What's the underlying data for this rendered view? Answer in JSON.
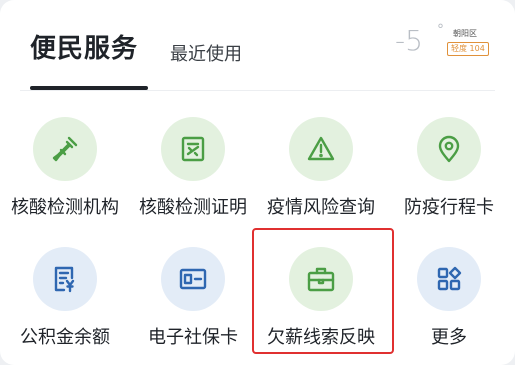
{
  "header": {
    "tab_main": "便民服务",
    "tab_secondary": "最近使用"
  },
  "weather": {
    "temperature": "-5",
    "degree_symbol": "°",
    "district": "朝阳区",
    "aqi_label": "轻度 104"
  },
  "services": [
    {
      "label": "核酸检测机构",
      "icon": "dropper-icon"
    },
    {
      "label": "核酸检测证明",
      "icon": "certificate-icon"
    },
    {
      "label": "疫情风险查询",
      "icon": "warning-icon"
    },
    {
      "label": "防疫行程卡",
      "icon": "location-pin-icon"
    },
    {
      "label": "公积金余额",
      "icon": "fund-document-icon"
    },
    {
      "label": "电子社保卡",
      "icon": "id-card-icon"
    },
    {
      "label": "欠薪线索反映",
      "icon": "briefcase-icon"
    },
    {
      "label": "更多",
      "icon": "more-grid-icon"
    }
  ],
  "colors": {
    "green_icon": "#4b9e45",
    "green_bg": "#e3f1df",
    "blue_icon": "#2f67b1",
    "blue_bg": "#e3ecf7",
    "highlight": "#e03030"
  }
}
